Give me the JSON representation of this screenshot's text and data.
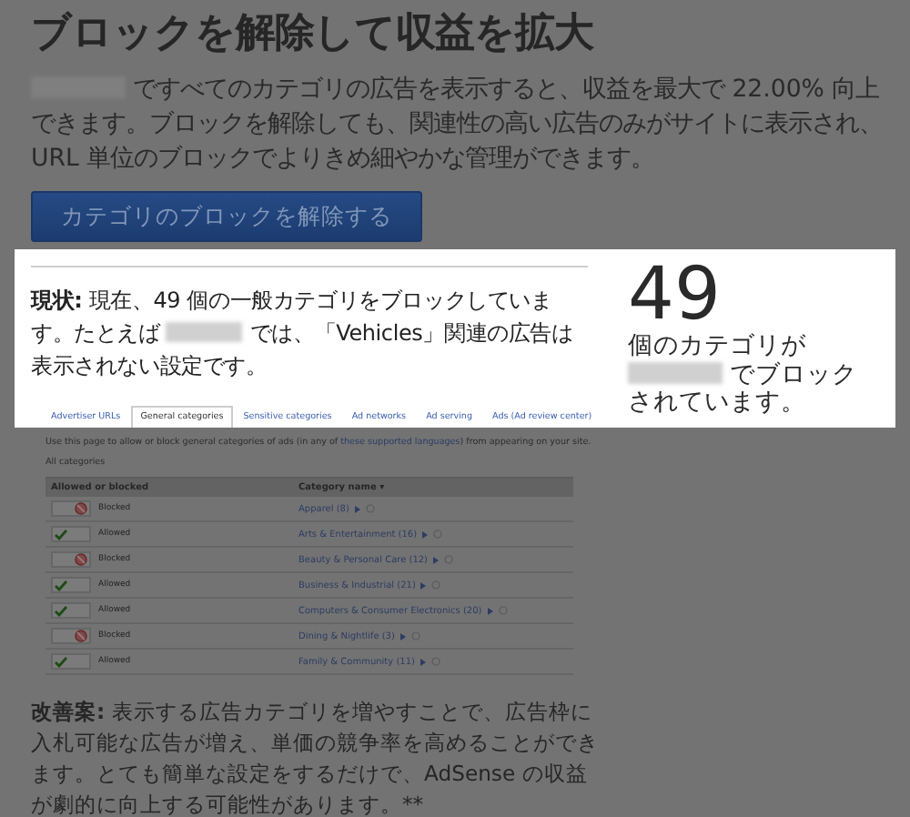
{
  "title": "ブロックを解除して収益を拡大",
  "intro": "ですべてのカテゴリの広告を表示すると、収益を最大で 22.00% 向上できます。ブロックを解除しても、関連性の高い広告のみがサイトに表示され、URL 単位のブロックでよりきめ細やかな管理ができます。",
  "unblock_button": "カテゴリのブロックを解除する",
  "status": {
    "label": "現状:",
    "before": "現在、49 個の一般カテゴリをブロックしています。たとえば",
    "after": "では、「Vehicles」関連の広告は表示されない設定です。"
  },
  "stat": {
    "number": "49",
    "lines": [
      {
        "text": "個のカテゴリが",
        "redacted_before": false
      },
      {
        "text": "でブロック",
        "redacted_before": true
      },
      {
        "text": "されています。",
        "redacted_before": false
      }
    ]
  },
  "screenshot": {
    "tabs": [
      {
        "label": "Advertiser URLs",
        "selected": false
      },
      {
        "label": "General categories",
        "selected": true
      },
      {
        "label": "Sensitive categories",
        "selected": false
      },
      {
        "label": "Ad networks",
        "selected": false
      },
      {
        "label": "Ad serving",
        "selected": false
      },
      {
        "label": "Ads (Ad review center)",
        "selected": false
      }
    ],
    "description": {
      "before": "Use this page to allow or block general categories of ads (in any of",
      "link": "these supported languages",
      "after": ") from appearing on your site."
    },
    "filter": "All categories",
    "columns": [
      "Allowed or blocked",
      "Category name ▾"
    ],
    "rows": [
      {
        "blocked": true,
        "status": "Blocked",
        "category": "Apparel (8)"
      },
      {
        "blocked": false,
        "status": "Allowed",
        "category": "Arts & Entertainment (16)"
      },
      {
        "blocked": true,
        "status": "Blocked",
        "category": "Beauty & Personal Care (12)"
      },
      {
        "blocked": false,
        "status": "Allowed",
        "category": "Business & Industrial (21)"
      },
      {
        "blocked": false,
        "status": "Allowed",
        "category": "Computers & Consumer Electronics (20)"
      },
      {
        "blocked": true,
        "status": "Blocked",
        "category": "Dining & Nightlife (3)"
      },
      {
        "blocked": false,
        "status": "Allowed",
        "category": "Family & Community (11)"
      }
    ]
  },
  "suggestion": {
    "label": "改善案:",
    "text": "表示する広告カテゴリを増やすことで、広告枠に入札可能な広告が増え、単価の競争率を高めることができます。とても簡単な設定をするだけで、AdSense の収益が劇的に向上する可能性があります。**"
  }
}
